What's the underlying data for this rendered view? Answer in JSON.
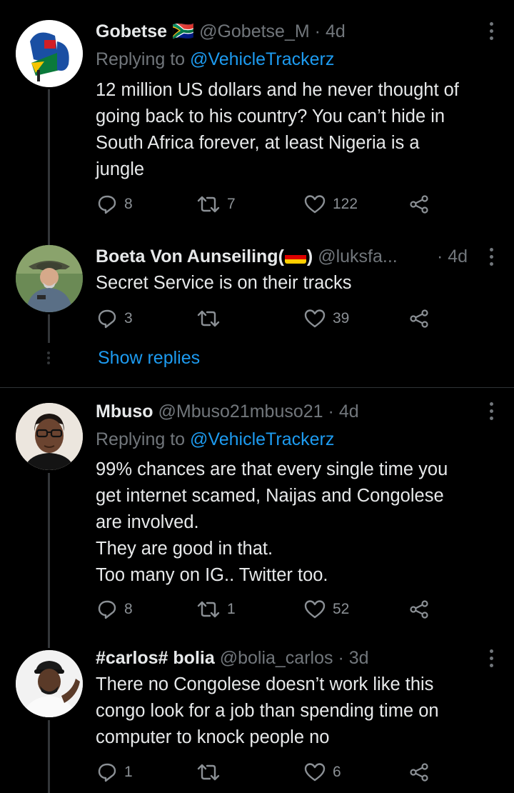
{
  "tweets": [
    {
      "name": "Gobetse",
      "flag": "🇿🇦",
      "handle": "@Gobetse_M",
      "dot": "·",
      "time": "4d",
      "replying_prefix": "Replying to",
      "replying_to": "@VehicleTrackerz",
      "lines": [
        "12 million US dollars and he never thought of",
        "going back to his country? You can’t hide in",
        "South Africa forever, at least Nigeria is a",
        "jungle"
      ],
      "replies": "8",
      "retweets": "7",
      "likes": "122"
    },
    {
      "name": "Boeta Von Aunseiling(",
      "name_suffix": ")",
      "handle": "@luksfa...",
      "dot": "·",
      "time": "4d",
      "lines": [
        "Secret Service is on their tracks"
      ],
      "replies": "3",
      "retweets": "",
      "likes": "39"
    },
    {
      "name": "Mbuso",
      "handle": "@Mbuso21mbuso21",
      "dot": "·",
      "time": "4d",
      "replying_prefix": "Replying to",
      "replying_to": "@VehicleTrackerz",
      "lines": [
        "99% chances are that every single time you",
        "get internet scamed, Naijas and Congolese",
        "are involved.",
        "They are good in that.",
        "Too many on IG.. Twitter too."
      ],
      "replies": "8",
      "retweets": "1",
      "likes": "52"
    },
    {
      "name": "#carlos# bolia",
      "handle": "@bolia_carlos",
      "dot": "·",
      "time": "3d",
      "lines": [
        "There no Congolese doesn’t work like this",
        "congo look for a job than spending time on",
        "computer to knock people no"
      ],
      "replies": "1",
      "retweets": "",
      "likes": "6"
    }
  ],
  "show_replies": "Show replies",
  "colors": {
    "background": "#000000",
    "text": "#e7e9ea",
    "secondary": "#71767b",
    "link": "#1d9bf0"
  }
}
